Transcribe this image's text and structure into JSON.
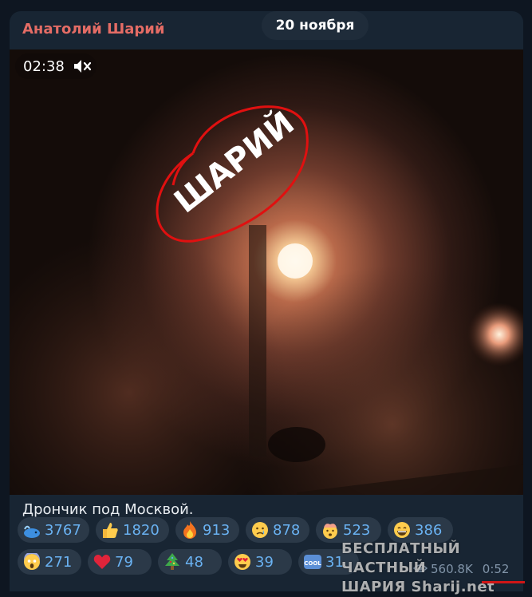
{
  "post": {
    "author": "Анатолий Шарий",
    "date": "20 ноября",
    "caption": "Дрончик под Москвой."
  },
  "video": {
    "duration": "02:38",
    "muted": true,
    "overlay_text": "ШАРИЙ"
  },
  "reactions": [
    {
      "emoji": "whale-icon",
      "count": "3767"
    },
    {
      "emoji": "thumbs-up-icon",
      "count": "1820"
    },
    {
      "emoji": "fire-icon",
      "count": "913"
    },
    {
      "emoji": "crying-face-icon",
      "count": "878"
    },
    {
      "emoji": "mind-blown-icon",
      "count": "523"
    },
    {
      "emoji": "grinning-face-icon",
      "count": "386"
    },
    {
      "emoji": "screaming-face-icon",
      "count": "271"
    },
    {
      "emoji": "heart-icon",
      "count": "79"
    },
    {
      "emoji": "christmas-tree-icon",
      "count": "48"
    },
    {
      "emoji": "heart-eyes-icon",
      "count": "39"
    },
    {
      "emoji": "cool-icon",
      "count": "31"
    }
  ],
  "watermark": {
    "line1": "БЕСПЛАТНЫЙ ЧАСТНЫЙ",
    "line2": "ШАРИЯ Sharij.net"
  },
  "meta": {
    "views": "560.8K",
    "time": "0:52"
  },
  "colors": {
    "background": "#0e1621",
    "bubble": "#182533",
    "author": "#e46c65",
    "reaction_count": "#6ab2f2"
  }
}
